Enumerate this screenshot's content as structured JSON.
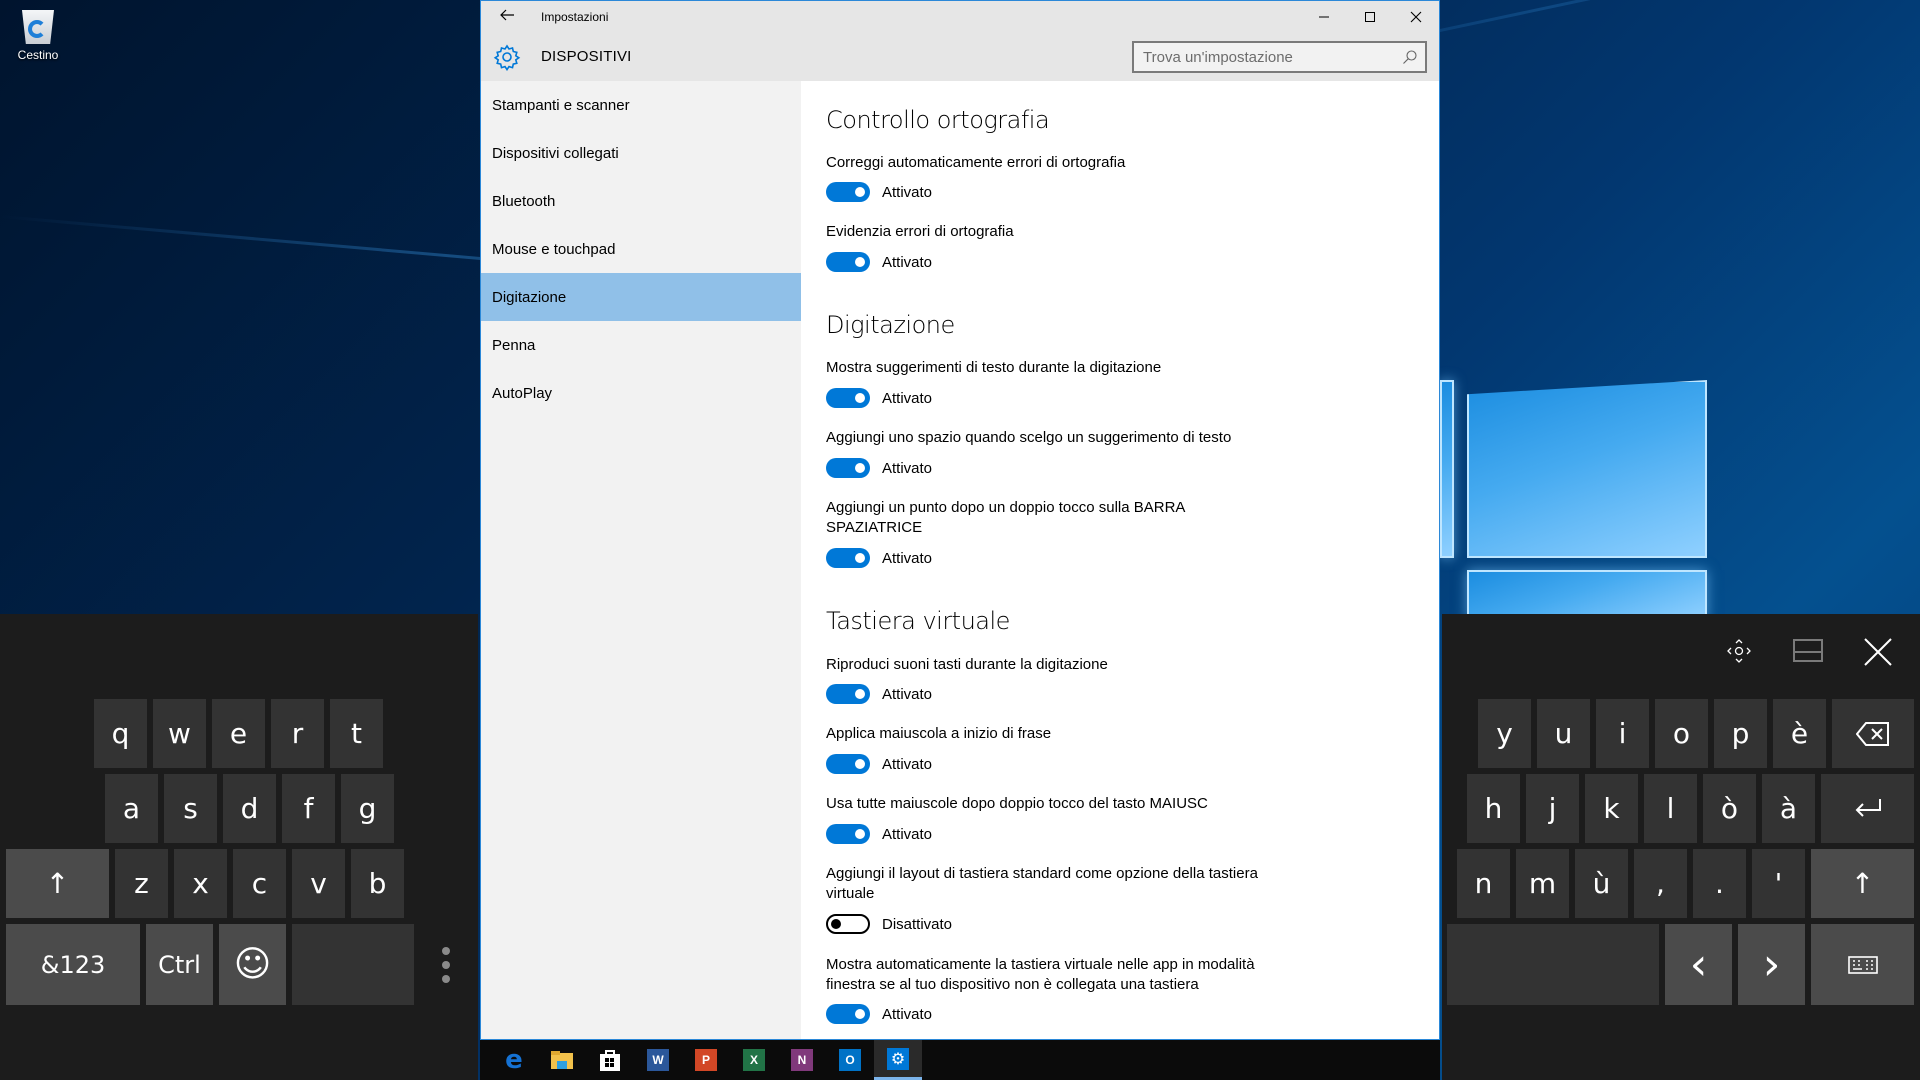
{
  "desktop": {
    "icons": [
      {
        "label": "Cestino",
        "icon": "recycle-bin-icon"
      }
    ]
  },
  "window": {
    "title": "Impostazioni",
    "section_title": "DISPOSITIVI",
    "section_icon": "gear-icon",
    "search": {
      "placeholder": "Trova un'impostazione",
      "value": ""
    },
    "controls": {
      "minimize": "minimize-icon",
      "maximize": "maximize-icon",
      "close": "close-icon"
    }
  },
  "sidebar": {
    "selected": "Digitazione",
    "items": [
      {
        "label": "Stampanti e scanner"
      },
      {
        "label": "Dispositivi collegati"
      },
      {
        "label": "Bluetooth"
      },
      {
        "label": "Mouse e touchpad"
      },
      {
        "label": "Digitazione"
      },
      {
        "label": "Penna"
      },
      {
        "label": "AutoPlay"
      }
    ]
  },
  "content": {
    "sections": [
      {
        "title": "Controllo ortografia",
        "settings": [
          {
            "label": "Correggi automaticamente errori di ortografia",
            "state": "Attivato",
            "on": true
          },
          {
            "label": "Evidenzia errori di ortografia",
            "state": "Attivato",
            "on": true
          }
        ]
      },
      {
        "title": "Digitazione",
        "settings": [
          {
            "label": "Mostra suggerimenti di testo durante la digitazione",
            "state": "Attivato",
            "on": true
          },
          {
            "label": "Aggiungi uno spazio quando scelgo un suggerimento di testo",
            "state": "Attivato",
            "on": true
          },
          {
            "label": "Aggiungi un punto dopo un doppio tocco sulla BARRA SPAZIATRICE",
            "state": "Attivato",
            "on": true
          }
        ]
      },
      {
        "title": "Tastiera virtuale",
        "settings": [
          {
            "label": "Riproduci suoni tasti durante la digitazione",
            "state": "Attivato",
            "on": true
          },
          {
            "label": "Applica maiuscola a inizio di frase",
            "state": "Attivato",
            "on": true
          },
          {
            "label": "Usa tutte maiuscole dopo doppio tocco del tasto MAIUSC",
            "state": "Attivato",
            "on": true
          },
          {
            "label": "Aggiungi il layout di tastiera standard come opzione della tastiera virtuale",
            "state": "Disattivato",
            "on": false
          },
          {
            "label": "Mostra automaticamente la tastiera virtuale nelle app in modalità finestra se al tuo dispositivo non è collegata una tastiera",
            "state": "Attivato",
            "on": true
          }
        ]
      }
    ]
  },
  "keyboard": {
    "left": {
      "row1": [
        "q",
        "w",
        "e",
        "r",
        "t"
      ],
      "row2": [
        "a",
        "s",
        "d",
        "f",
        "g"
      ],
      "row3": [
        "z",
        "x",
        "c",
        "v",
        "b"
      ],
      "shift": "↑",
      "symbols": "&123",
      "ctrl": "Ctrl",
      "emoji": "☺",
      "more": "more-options-icon"
    },
    "right": {
      "row1": [
        "y",
        "u",
        "i",
        "o",
        "p",
        "è"
      ],
      "row2": [
        "h",
        "j",
        "k",
        "l",
        "ò",
        "à"
      ],
      "row3": [
        "n",
        "m",
        "ù",
        ",",
        ".",
        "'"
      ],
      "backspace": "backspace-icon",
      "enter": "enter-icon",
      "shift": "↑",
      "left_arrow": "‹",
      "right_arrow": "›",
      "keyboard_key": "keyboard-icon"
    },
    "controls": [
      "move-icon",
      "dock-icon",
      "close-icon"
    ]
  },
  "taskbar": {
    "apps": [
      {
        "name": "Microsoft Edge",
        "glyph": "e",
        "color": "#1572d4"
      },
      {
        "name": "Esplora file",
        "glyph": "",
        "color": "#f2c14b"
      },
      {
        "name": "Store",
        "glyph": "",
        "color": "#ffffff"
      },
      {
        "name": "Word",
        "glyph": "W",
        "color": "#2b579a"
      },
      {
        "name": "PowerPoint",
        "glyph": "P",
        "color": "#d24726"
      },
      {
        "name": "Excel",
        "glyph": "X",
        "color": "#217346"
      },
      {
        "name": "OneNote",
        "glyph": "N",
        "color": "#80397b"
      },
      {
        "name": "Outlook",
        "glyph": "O",
        "color": "#0072c6"
      },
      {
        "name": "Impostazioni",
        "glyph": "⚙",
        "color": "#0078d7",
        "active": true
      }
    ]
  },
  "colors": {
    "accent": "#0078d7",
    "selected_nav": "#90c0e8",
    "keyboard_bg": "#1c1c1c",
    "key": "#333333",
    "key_fn": "#4b4b4b"
  }
}
